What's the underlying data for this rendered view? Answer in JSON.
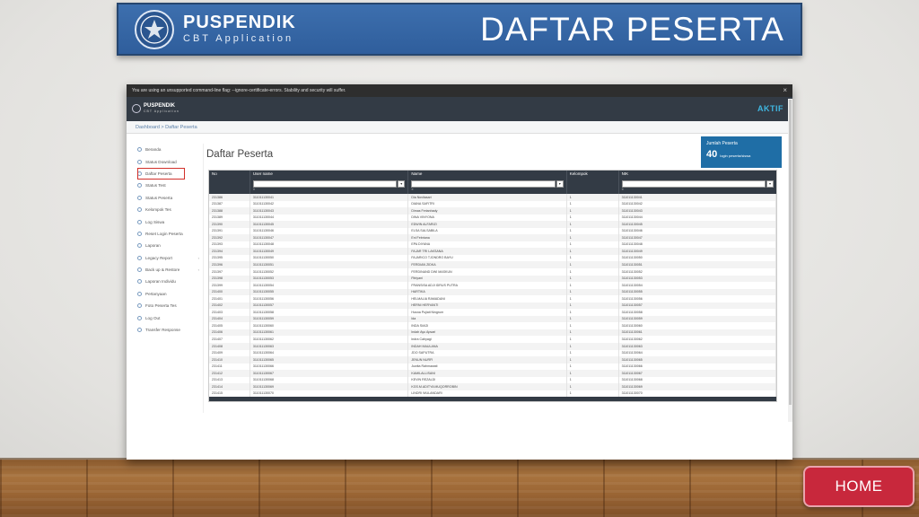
{
  "slide": {
    "brand_name": "PUSPENDIK",
    "brand_sub": "CBT Application",
    "title": "DAFTAR PESERTA",
    "home_label": "HOME"
  },
  "browser": {
    "infobar_text": "You are using an unsupported command-line flag: --ignore-certificate-errors. Stability and security will suffer.",
    "close_glyph": "×"
  },
  "app": {
    "brand": "PUSPENDIK",
    "brand_sub": "CBT Application",
    "status": "AKTIF",
    "breadcrumb": "Dashboard > Daftar Peserta",
    "page_title": "Daftar Peserta",
    "count_label": "Jumlah Peserta",
    "count_value": "40",
    "count_unit": "login peserta/siswa"
  },
  "sidebar": {
    "items": [
      {
        "label": "Beranda"
      },
      {
        "label": "Status Download"
      },
      {
        "label": "Daftar Peserta",
        "active": true
      },
      {
        "label": "Status Test"
      },
      {
        "label": "Status Peserta"
      },
      {
        "label": "Kelompok Tes"
      },
      {
        "label": "Log Siswa"
      },
      {
        "label": "Reset Login Peserta"
      },
      {
        "label": "Laporan"
      },
      {
        "label": "Legacy Report",
        "chevron": "‹"
      },
      {
        "label": "Back up & Restore",
        "chevron": "‹"
      },
      {
        "label": "Laporan Individu"
      },
      {
        "label": "Pertanyaan"
      },
      {
        "label": "Foto Peserta Tes"
      },
      {
        "label": "Log Out"
      },
      {
        "label": "Transfer Response"
      }
    ]
  },
  "table": {
    "headers": [
      "No",
      "User name",
      "Name",
      "Kelompok",
      "NIK"
    ],
    "filter_sub": "≡",
    "filter_btn": "▾",
    "rows": [
      [
        "231386",
        "311011130041",
        "Dia Novitasari",
        "1",
        "311011130041"
      ],
      [
        "231387",
        "311011130042",
        "DIANA SAFITRI",
        "1",
        "311011130042"
      ],
      [
        "231388",
        "311011130043",
        "Dimas Ferianhady",
        "1",
        "311011130043"
      ],
      [
        "231389",
        "311011130044",
        "DINA VINYONA",
        "1",
        "311011130044"
      ],
      [
        "231390",
        "311011130045",
        "EDWIN ALFARIZI",
        "1",
        "311011130045"
      ],
      [
        "231391",
        "311011130046",
        "ELSA SALSABILA",
        "1",
        "311011130046"
      ],
      [
        "231392",
        "311011130047",
        "Eni Febriana",
        "1",
        "311011130047"
      ],
      [
        "231393",
        "311011130048",
        "EPA DIYANA",
        "1",
        "311011130048"
      ],
      [
        "231394",
        "311011130049",
        "FAJAR TRI LAKSANA",
        "1",
        "311011130049"
      ],
      [
        "231395",
        "311011130050",
        "FAJARICO TJONDRO BAYU",
        "1",
        "311011130050"
      ],
      [
        "231396",
        "311011130051",
        "FERDIAN ZIDKA",
        "1",
        "311011130051"
      ],
      [
        "231397",
        "311011130052",
        "FERDINAND DWI MASKUN",
        "1",
        "311011130052"
      ],
      [
        "231398",
        "311011130053",
        "Fitriyani",
        "1",
        "311011130053"
      ],
      [
        "231399",
        "311011130054",
        "FRANSISA ADJI IDRUS PUTRA",
        "1",
        "311011130054"
      ],
      [
        "231400",
        "311011130055",
        "HARTIKA",
        "1",
        "311011130055"
      ],
      [
        "231401",
        "311011130056",
        "HELMALIA RAMADANI",
        "1",
        "311011130056"
      ],
      [
        "231402",
        "311011130057",
        "HERNI HERYANTI",
        "1",
        "311011130057"
      ],
      [
        "231403",
        "311011130058",
        "Husna Pujiati Ningrum",
        "1",
        "311011130058"
      ],
      [
        "231404",
        "311011130059",
        "Ida",
        "1",
        "311011130059"
      ],
      [
        "231405",
        "311011130060",
        "INDA SIAGI",
        "1",
        "311011130060"
      ],
      [
        "231406",
        "311011130061",
        "Indah Ayu Apsari",
        "1",
        "311011130061"
      ],
      [
        "231407",
        "311011130062",
        "Indra Cahyagi",
        "1",
        "311011130062"
      ],
      [
        "231408",
        "311011130063",
        "INDAH MAULANA",
        "1",
        "311011130063"
      ],
      [
        "231409",
        "311011130064",
        "JDO SAPUTRA",
        "1",
        "311011130064"
      ],
      [
        "231410",
        "311011130065",
        "JENUN NURFI",
        "1",
        "311011130065"
      ],
      [
        "231411",
        "311011130066",
        "Juwita Rahmawati",
        "1",
        "311011130066"
      ],
      [
        "231412",
        "311011130067",
        "KAMILALLISANI",
        "1",
        "311011130067"
      ],
      [
        "231413",
        "311011130068",
        "KEVIN REZALDI",
        "1",
        "311011130068"
      ],
      [
        "231414",
        "311011130069",
        "KGS.M.ADITYA MUQORROBIN",
        "1",
        "311011130069"
      ],
      [
        "231415",
        "311011130070",
        "LINDRI WULANDARI",
        "1",
        "311011130070"
      ]
    ]
  },
  "colors": {
    "banner": "#2f5e9c",
    "app_bar": "#333b45",
    "accent": "#3fb6e0",
    "count_box": "#1f6ea6",
    "home_button": "#c8283c",
    "active_outline": "#d2302a"
  }
}
